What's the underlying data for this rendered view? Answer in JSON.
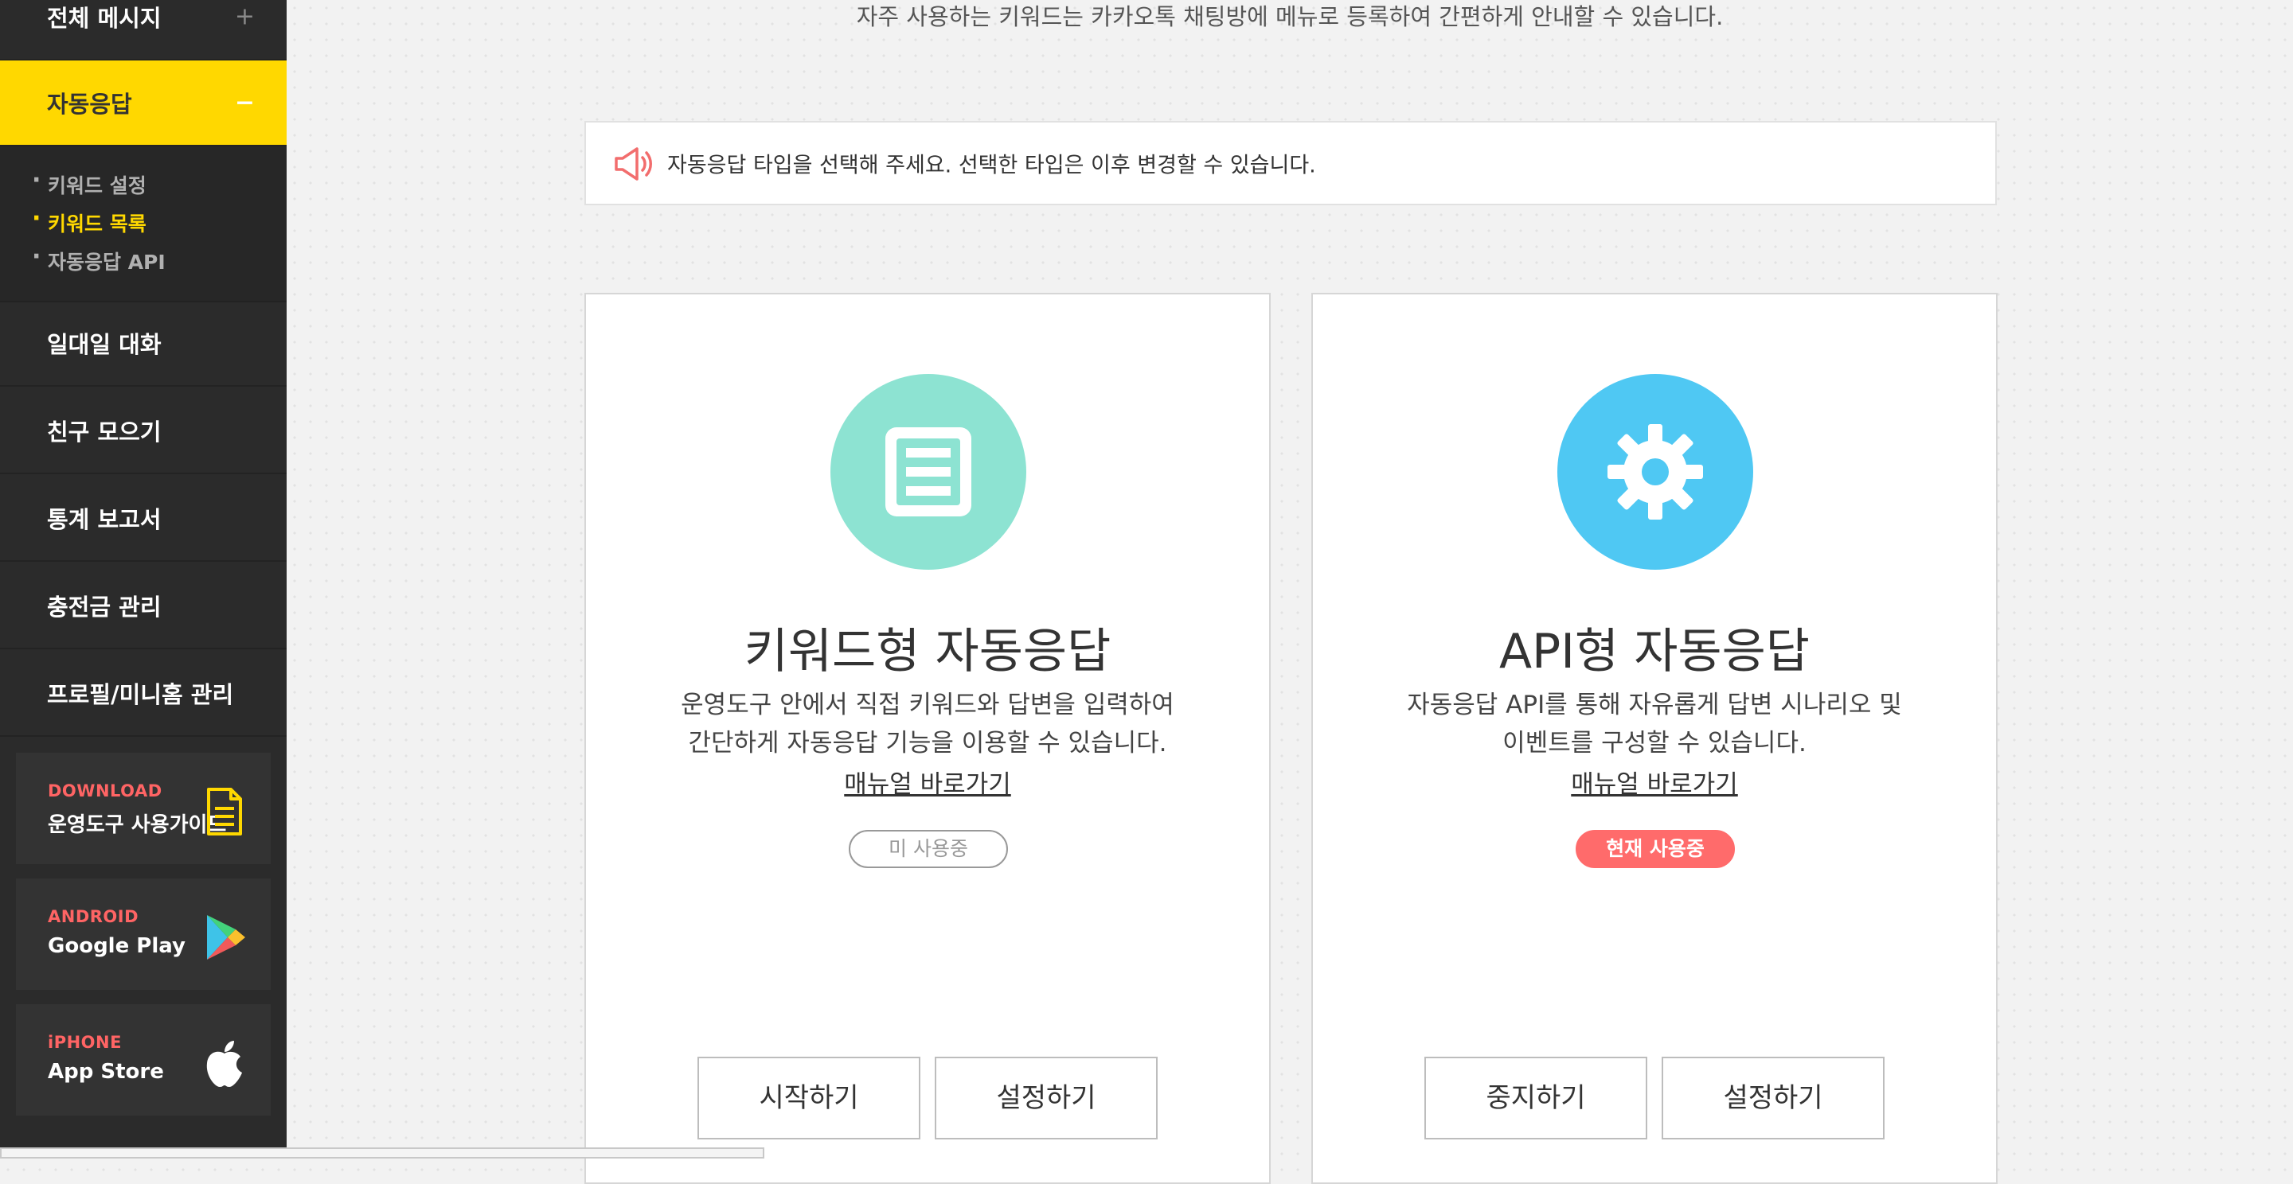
{
  "sidebar": {
    "nav": {
      "all_messages": {
        "label": "전체 메시지",
        "toggle": "+"
      },
      "auto_reply": {
        "label": "자동응답",
        "toggle": "−"
      },
      "one_on_one": {
        "label": "일대일 대화"
      },
      "gather_friends": {
        "label": "친구 모으기"
      },
      "stats_report": {
        "label": "통계 보고서"
      },
      "charge_management": {
        "label": "충전금 관리"
      },
      "profile_management": {
        "label": "프로필/미니홈 관리"
      }
    },
    "submenu": [
      {
        "label": "키워드 설정"
      },
      {
        "label": "키워드 목록",
        "current": true
      },
      {
        "label": "자동응답 API"
      }
    ],
    "promos": {
      "download": {
        "kicker": "DOWNLOAD",
        "title": "운영도구 사용가이드",
        "icon": "document-icon"
      },
      "android": {
        "kicker": "ANDROID",
        "title": "Google Play",
        "icon": "google-play-icon"
      },
      "iphone": {
        "kicker": "iPHONE",
        "title": "App Store",
        "icon": "apple-icon"
      }
    }
  },
  "main": {
    "top_description": "자주 사용하는 키워드는 카카오톡 채팅방에 메뉴로 등록하여 간편하게 안내할 수 있습니다.",
    "notice": {
      "icon": "megaphone-icon",
      "text": "자동응답 타입을 선택해 주세요. 선택한 타입은 이후 변경할 수 있습니다."
    },
    "cards": {
      "keyword": {
        "icon": "list-icon",
        "circle_color": "#8de3d2",
        "title": "키워드형 자동응답",
        "desc_line1": "운영도구 안에서 직접 키워드와 답변을 입력하여",
        "desc_line2": "간단하게 자동응답 기능을 이용할 수 있습니다.",
        "manual_link": "매뉴얼 바로가기",
        "status": "미 사용중",
        "buttons": {
          "primary": "시작하기",
          "secondary": "설정하기"
        }
      },
      "api": {
        "icon": "gear-icon",
        "circle_color": "#4fc8f3",
        "title": "API형 자동응답",
        "desc_line1": "자동응답 API를 통해 자유롭게 답변 시나리오 및",
        "desc_line2": "이벤트를 구성할 수 있습니다.",
        "manual_link": "매뉴얼 바로가기",
        "status": "현재 사용중",
        "buttons": {
          "primary": "중지하기",
          "secondary": "설정하기"
        }
      }
    }
  },
  "colors": {
    "accent_yellow": "#ffd800",
    "sidebar_bg": "#2b2b2b",
    "status_active": "#ff6b6b",
    "promo_kicker": "#ff6464"
  }
}
